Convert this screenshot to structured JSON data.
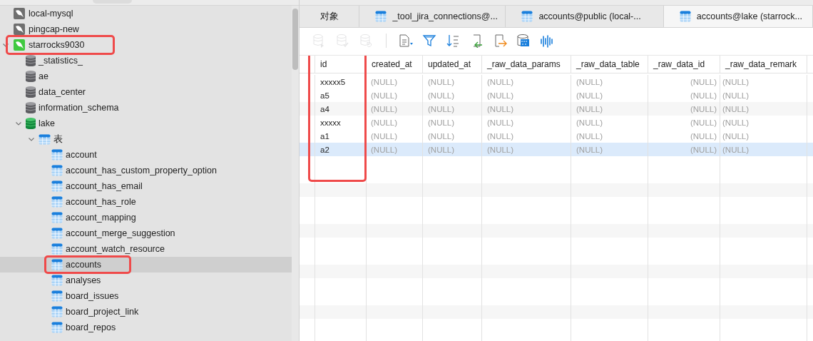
{
  "tree": [
    {
      "label": "local-mysql",
      "kind": "server",
      "connected": false
    },
    {
      "label": "pingcap-new",
      "kind": "server",
      "connected": false
    },
    {
      "label": "starrocks9030",
      "kind": "server",
      "connected": true,
      "expanded": true,
      "highlighted": true,
      "children": [
        {
          "label": "_statistics_",
          "kind": "database",
          "connected": false
        },
        {
          "label": "ae",
          "kind": "database",
          "connected": false
        },
        {
          "label": "data_center",
          "kind": "database",
          "connected": false
        },
        {
          "label": "information_schema",
          "kind": "database",
          "connected": false
        },
        {
          "label": "lake",
          "kind": "database",
          "connected": true,
          "expanded": true,
          "children": [
            {
              "label": "表",
              "kind": "folder",
              "expanded": true,
              "children": [
                {
                  "label": "account",
                  "kind": "table",
                  "selected": false
                },
                {
                  "label": "account_has_custom_property_option",
                  "kind": "table",
                  "selected": false
                },
                {
                  "label": "account_has_email",
                  "kind": "table",
                  "selected": false
                },
                {
                  "label": "account_has_role",
                  "kind": "table",
                  "selected": false
                },
                {
                  "label": "account_mapping",
                  "kind": "table",
                  "selected": false
                },
                {
                  "label": "account_merge_suggestion",
                  "kind": "table",
                  "selected": false
                },
                {
                  "label": "account_watch_resource",
                  "kind": "table",
                  "selected": false
                },
                {
                  "label": "accounts",
                  "kind": "table",
                  "selected": true,
                  "highlighted": true
                },
                {
                  "label": "analyses",
                  "kind": "table",
                  "selected": false
                },
                {
                  "label": "board_issues",
                  "kind": "table",
                  "selected": false
                },
                {
                  "label": "board_project_link",
                  "kind": "table",
                  "selected": false
                },
                {
                  "label": "board_repos",
                  "kind": "table",
                  "selected": false
                }
              ]
            }
          ]
        }
      ]
    }
  ],
  "tabs": [
    {
      "label": "对象",
      "kind": "objects",
      "selected": false
    },
    {
      "label": "_tool_jira_connections@...",
      "kind": "table",
      "selected": false
    },
    {
      "label": "accounts@public (local-...",
      "kind": "table",
      "selected": false
    },
    {
      "label": "accounts@lake (starrock...",
      "kind": "table",
      "selected": true
    }
  ],
  "toolbar": [
    {
      "kind": "db-add",
      "disabled": true
    },
    {
      "kind": "db-check",
      "disabled": true
    },
    {
      "kind": "db-undo",
      "disabled": true
    },
    {
      "kind": "sep"
    },
    {
      "kind": "doc",
      "disabled": false
    },
    {
      "kind": "filter",
      "disabled": false
    },
    {
      "kind": "sort",
      "disabled": false
    },
    {
      "kind": "import",
      "disabled": false
    },
    {
      "kind": "export",
      "disabled": false
    },
    {
      "kind": "binary",
      "disabled": false
    },
    {
      "kind": "wave",
      "disabled": false
    }
  ],
  "table": {
    "columns": [
      {
        "label": "id",
        "highlighted": true
      },
      {
        "label": "created_at"
      },
      {
        "label": "updated_at"
      },
      {
        "label": "_raw_data_params"
      },
      {
        "label": "_raw_data_table"
      },
      {
        "label": "_raw_data_id",
        "right_aligned": true
      },
      {
        "label": "_raw_data_remark"
      }
    ],
    "rows": [
      {
        "selected": false,
        "cells": [
          "xxxxx5",
          "(NULL)",
          "(NULL)",
          "(NULL)",
          "(NULL)",
          "(NULL)",
          "(NULL)"
        ]
      },
      {
        "selected": false,
        "cells": [
          "a5",
          "(NULL)",
          "(NULL)",
          "(NULL)",
          "(NULL)",
          "(NULL)",
          "(NULL)"
        ]
      },
      {
        "selected": false,
        "cells": [
          "a4",
          "(NULL)",
          "(NULL)",
          "(NULL)",
          "(NULL)",
          "(NULL)",
          "(NULL)"
        ]
      },
      {
        "selected": false,
        "cells": [
          "xxxxx",
          "(NULL)",
          "(NULL)",
          "(NULL)",
          "(NULL)",
          "(NULL)",
          "(NULL)"
        ]
      },
      {
        "selected": false,
        "cells": [
          "a1",
          "(NULL)",
          "(NULL)",
          "(NULL)",
          "(NULL)",
          "(NULL)",
          "(NULL)"
        ]
      },
      {
        "selected": true,
        "cells": [
          "a2",
          "(NULL)",
          "(NULL)",
          "(NULL)",
          "(NULL)",
          "(NULL)",
          "(NULL)"
        ]
      }
    ]
  }
}
